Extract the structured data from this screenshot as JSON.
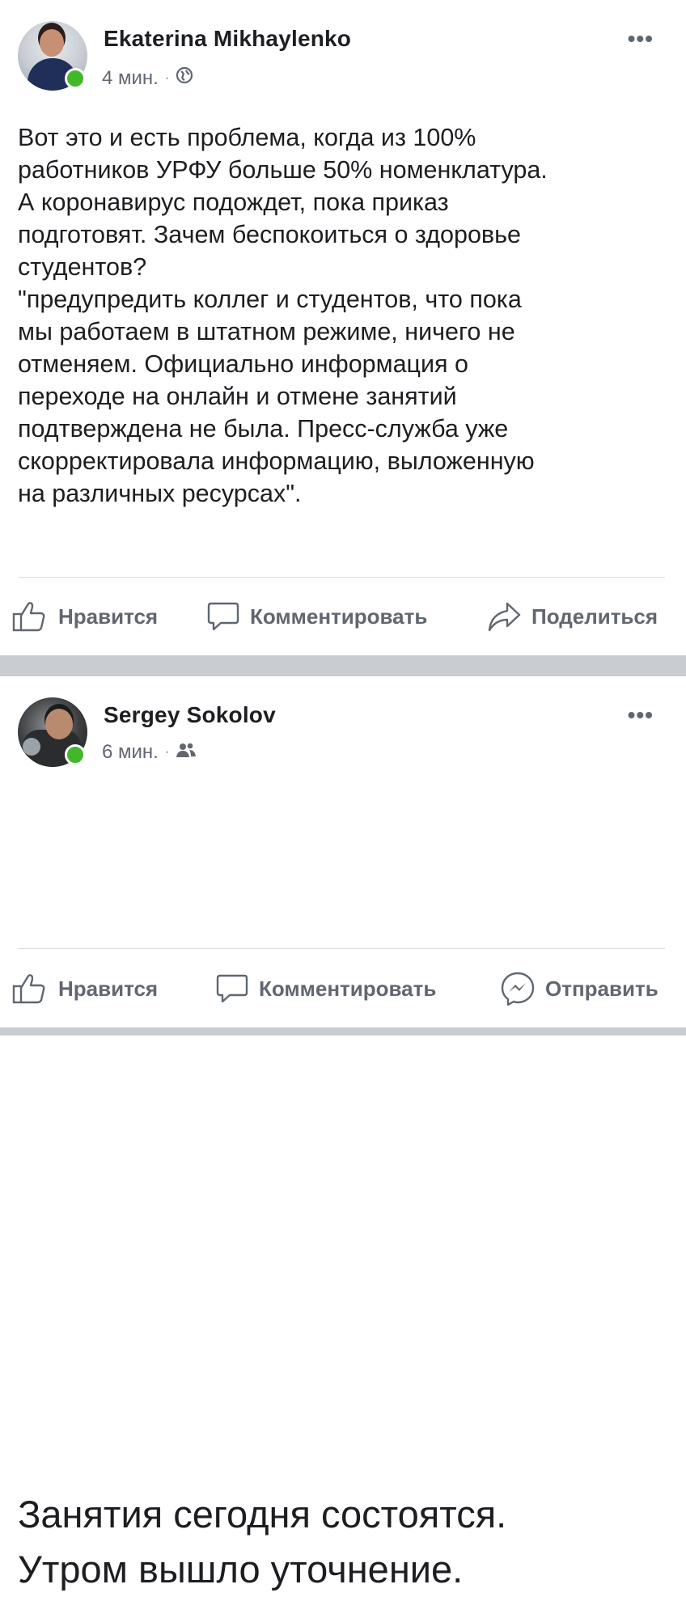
{
  "posts": [
    {
      "author": "Ekaterina Mikhaylenko",
      "time": "4 мин.",
      "sep": "·",
      "audience_icon": "globe-icon",
      "text_lines": [
        "Вот это и есть проблема, когда из 100%",
        "работников УРФУ больше 50% номенклатура.",
        "А коронавирус подождет, пока приказ",
        "подготовят. Зачем беспокоиться о здоровье",
        "студентов?",
        "\"предупредить коллег и студентов, что пока",
        "мы работаем в штатном режиме, ничего не",
        "отменяем. Официально информация о",
        "переходе на онлайн и отмене занятий",
        "подтверждена не была. Пресс-служба уже",
        "скорректировала информацию, выложенную",
        "на различных ресурсах\"."
      ],
      "actions": {
        "like": "Нравится",
        "comment": "Комментировать",
        "share": "Поделиться"
      }
    },
    {
      "author": "Sergey Sokolov",
      "time": "6 мин.",
      "sep": "·",
      "audience_icon": "friends-icon",
      "text_lines": [
        "Занятия сегодня состоятся.",
        "Утром вышло уточнение."
      ],
      "actions": {
        "like": "Нравится",
        "comment": "Комментировать",
        "send": "Отправить"
      }
    }
  ],
  "more_label": "•••",
  "colors": {
    "online": "#42b72a",
    "secondary_text": "#606770",
    "separator": "#c9ccd1"
  }
}
